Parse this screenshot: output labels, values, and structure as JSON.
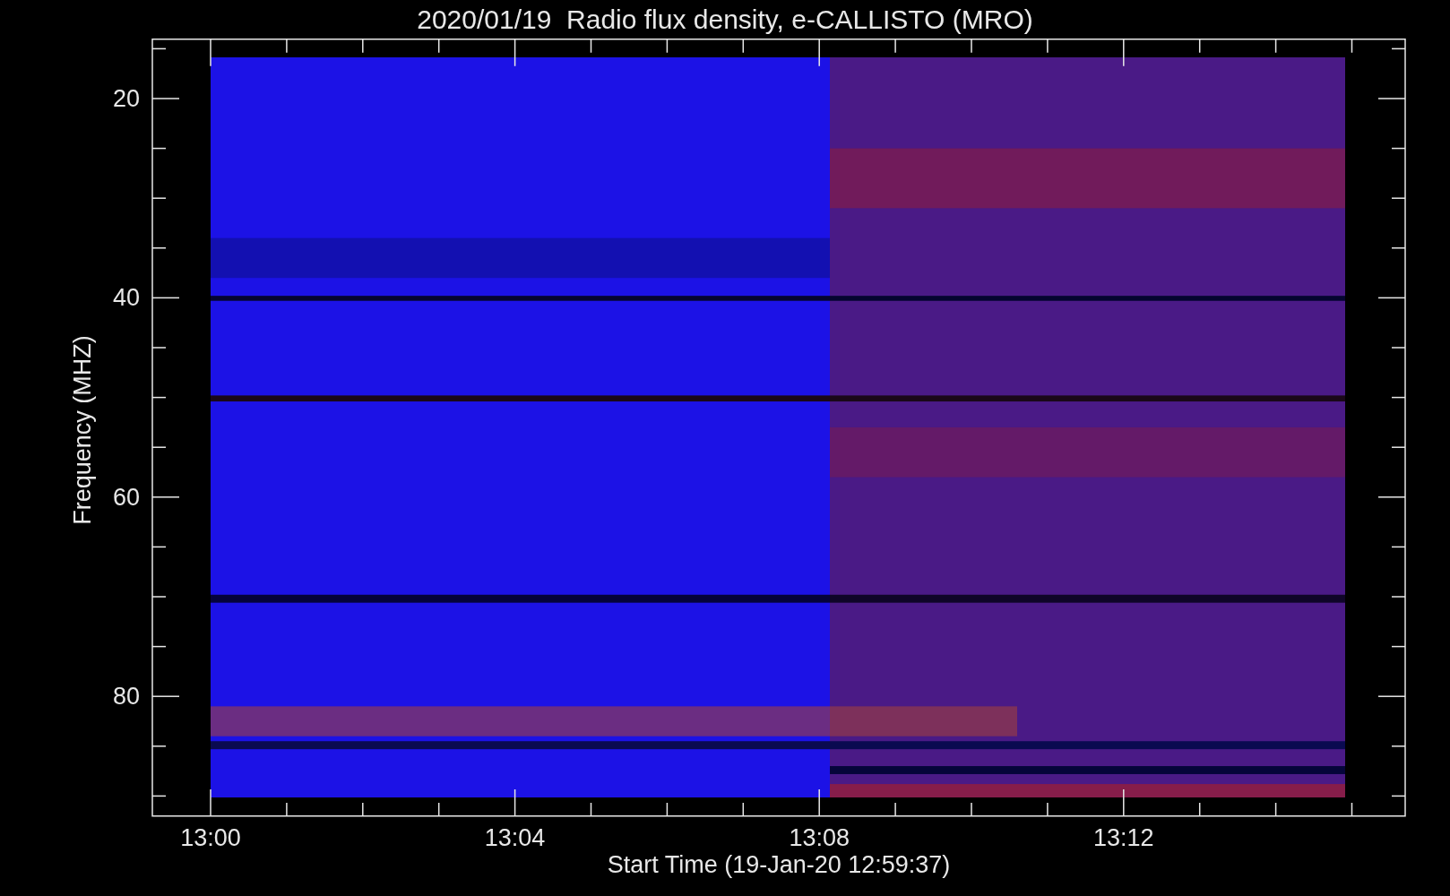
{
  "title": "2020/01/19  Radio flux density, e-CALLISTO (MRO)",
  "y_axis": {
    "label": "Frequency (MHZ)",
    "ticks": [
      "20",
      "40",
      "60",
      "80"
    ]
  },
  "x_axis": {
    "label": "Start Time (19-Jan-20 12:59:37)",
    "ticks": [
      "13:00",
      "13:04",
      "13:08",
      "13:12"
    ]
  }
}
